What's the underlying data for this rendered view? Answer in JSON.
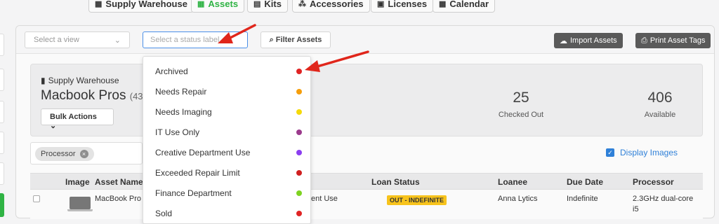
{
  "nav": [
    {
      "label": "Supply Warehouse",
      "icon": "building-icon",
      "active": false
    },
    {
      "label": "Assets",
      "icon": "grid-icon",
      "active": true
    },
    {
      "label": "Kits",
      "icon": "briefcase-icon",
      "active": false
    },
    {
      "label": "Accessories",
      "icon": "cubes-icon",
      "active": false
    },
    {
      "label": "Licenses",
      "icon": "floppy-icon",
      "active": false
    },
    {
      "label": "Calendar",
      "icon": "calendar-icon",
      "active": false
    }
  ],
  "toolbar": {
    "view_placeholder": "Select a view",
    "status_placeholder": "Select a status label",
    "filter_label": "Filter Assets",
    "import_label": "Import Assets",
    "print_label": "Print Asset Tags"
  },
  "info": {
    "warehouse": "Supply Warehouse",
    "title": "Macbook Pros",
    "count_partial": "(43",
    "bulk_actions": "Bulk Actions",
    "stats": [
      {
        "value": "25",
        "label": "Checked Out"
      },
      {
        "value": "406",
        "label": "Available"
      }
    ]
  },
  "filters": {
    "chip": "Processor",
    "display_images": "Display Images"
  },
  "table": {
    "headers": [
      "Image",
      "Asset Name",
      "Loan Status",
      "Loanee",
      "Due Date",
      "Processor"
    ],
    "row": {
      "asset_name": "MacBook Pro",
      "partial_text": "ent Use",
      "loan_status": "OUT - INDEFINITE",
      "loanee": "Anna Lytics",
      "due_date": "Indefinite",
      "processor_line1": "2.3GHz dual-core",
      "processor_line2": "i5"
    }
  },
  "status_options": [
    {
      "label": "Archived",
      "color": "#e02424"
    },
    {
      "label": "Needs Repair",
      "color": "#f59e0b"
    },
    {
      "label": "Needs Imaging",
      "color": "#f5d90a"
    },
    {
      "label": "IT Use Only",
      "color": "#9b3a8c"
    },
    {
      "label": "Creative Department Use",
      "color": "#8b3ef0"
    },
    {
      "label": "Exceeded Repair Limit",
      "color": "#d01f1f"
    },
    {
      "label": "Finance Department",
      "color": "#7ed321"
    },
    {
      "label": "Sold",
      "color": "#e02424"
    }
  ],
  "colors": {
    "accent": "#2fb344",
    "link": "#2f80d8",
    "annotation_arrow": "#e0261b"
  }
}
